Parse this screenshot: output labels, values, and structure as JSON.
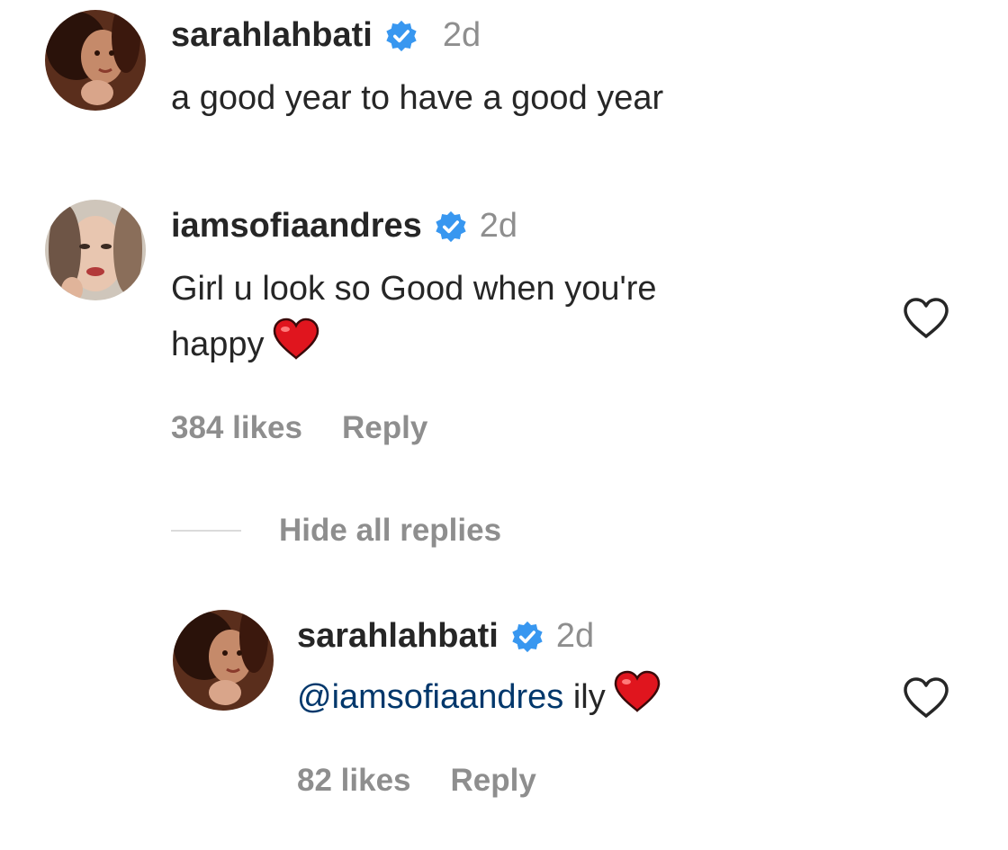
{
  "comments": [
    {
      "username": "sarahlahbati",
      "verified": true,
      "time": "2d",
      "text": "a good year to have a good year"
    },
    {
      "username": "iamsofiaandres",
      "verified": true,
      "time": "2d",
      "text_line1": "Girl u look so Good when you're",
      "text_line2": "happy",
      "emoji": "red-heart",
      "likes": "384 likes",
      "reply_label": "Reply"
    }
  ],
  "replies_toggle": "Hide all replies",
  "reply": {
    "username": "sarahlahbati",
    "verified": true,
    "time": "2d",
    "mention": "@iamsofiaandres",
    "text": " ily",
    "emoji": "red-heart",
    "likes": "82 likes",
    "reply_label": "Reply"
  },
  "colors": {
    "verified_badge": "#3897f0",
    "mention": "#00376b",
    "meta_text": "#8e8e8e",
    "heart_emoji": "#e0151e"
  },
  "icons": [
    "verified-badge-icon",
    "heart-outline-icon",
    "red-heart-emoji-icon"
  ]
}
